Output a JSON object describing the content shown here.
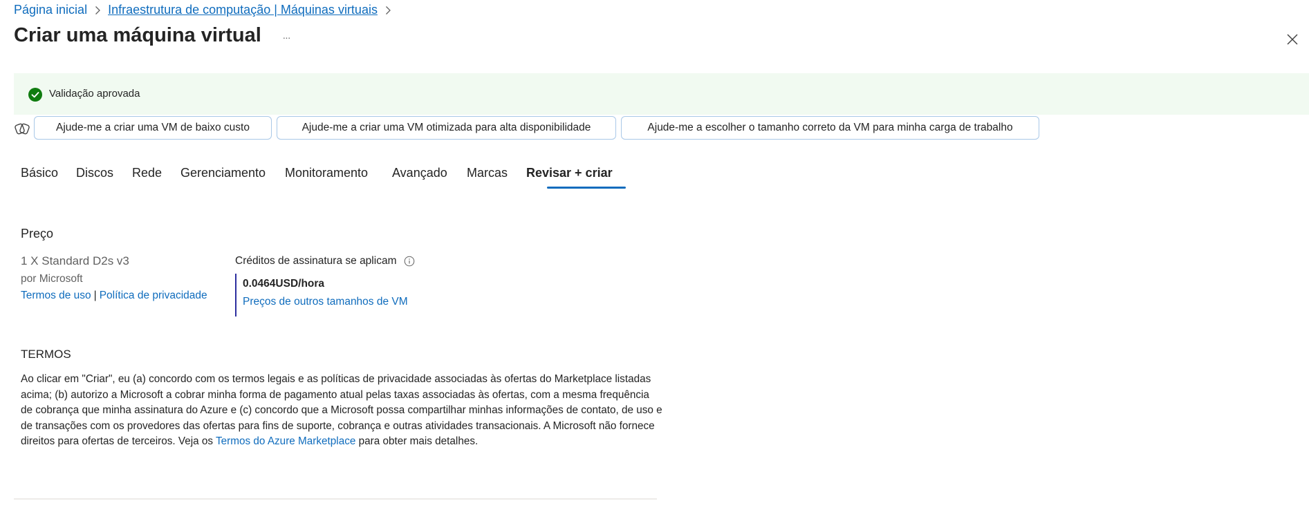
{
  "breadcrumb": {
    "home": "Página inicial",
    "current": "Infraestrutura de computação | Máquinas virtuais"
  },
  "page_title": "Criar uma máquina virtual",
  "more_label": "···",
  "validation": {
    "text": "Validação aprovada",
    "color": "#107c10"
  },
  "copilot_prompts": [
    "Ajude-me a criar uma VM de baixo custo",
    "Ajude-me a criar uma VM otimizada para alta disponibilidade",
    "Ajude-me a escolher o tamanho correto da VM para minha carga de trabalho"
  ],
  "tabs": [
    {
      "label": "Básico",
      "active": false
    },
    {
      "label": "Discos",
      "active": false
    },
    {
      "label": "Rede",
      "active": false
    },
    {
      "label": "Gerenciamento",
      "active": false
    },
    {
      "label": "Monitoramento",
      "active": false
    },
    {
      "label": "Avançado",
      "active": false
    },
    {
      "label": "Marcas",
      "active": false
    },
    {
      "label": "Revisar + criar",
      "active": true
    }
  ],
  "price": {
    "heading": "Preço",
    "vm_size": "1 X Standard D2s v3",
    "publisher": "por Microsoft",
    "terms_link": "Termos de uso",
    "separator": "|",
    "privacy_link": "Política de privacidade",
    "credits_label": "Créditos de assinatura se aplicam",
    "price_value": "0.0464USD/hora",
    "other_sizes_link": "Preços de outros tamanhos de VM"
  },
  "terms": {
    "heading": "TERMOS",
    "body_before_link": "Ao clicar em \"Criar\", eu (a) concordo com os termos legais e as políticas de privacidade associadas às ofertas do Marketplace listadas acima; (b) autorizo a Microsoft a cobrar minha forma de pagamento atual pelas taxas associadas às ofertas, com a mesma frequência de cobrança que minha assinatura do Azure e (c) concordo que a Microsoft possa compartilhar minhas informações de contato, de uso e de transações com os provedores das ofertas para fins de suporte, cobrança e outras atividades transacionais. A Microsoft não fornece direitos para ofertas de terceiros. Veja os ",
    "link": "Termos do Azure Marketplace",
    "body_after_link": " para obter mais detalhes."
  },
  "colors": {
    "accent": "#0f6cbd",
    "price_bar": "#2c2e9e",
    "validation_bg": "#f1faf1"
  }
}
